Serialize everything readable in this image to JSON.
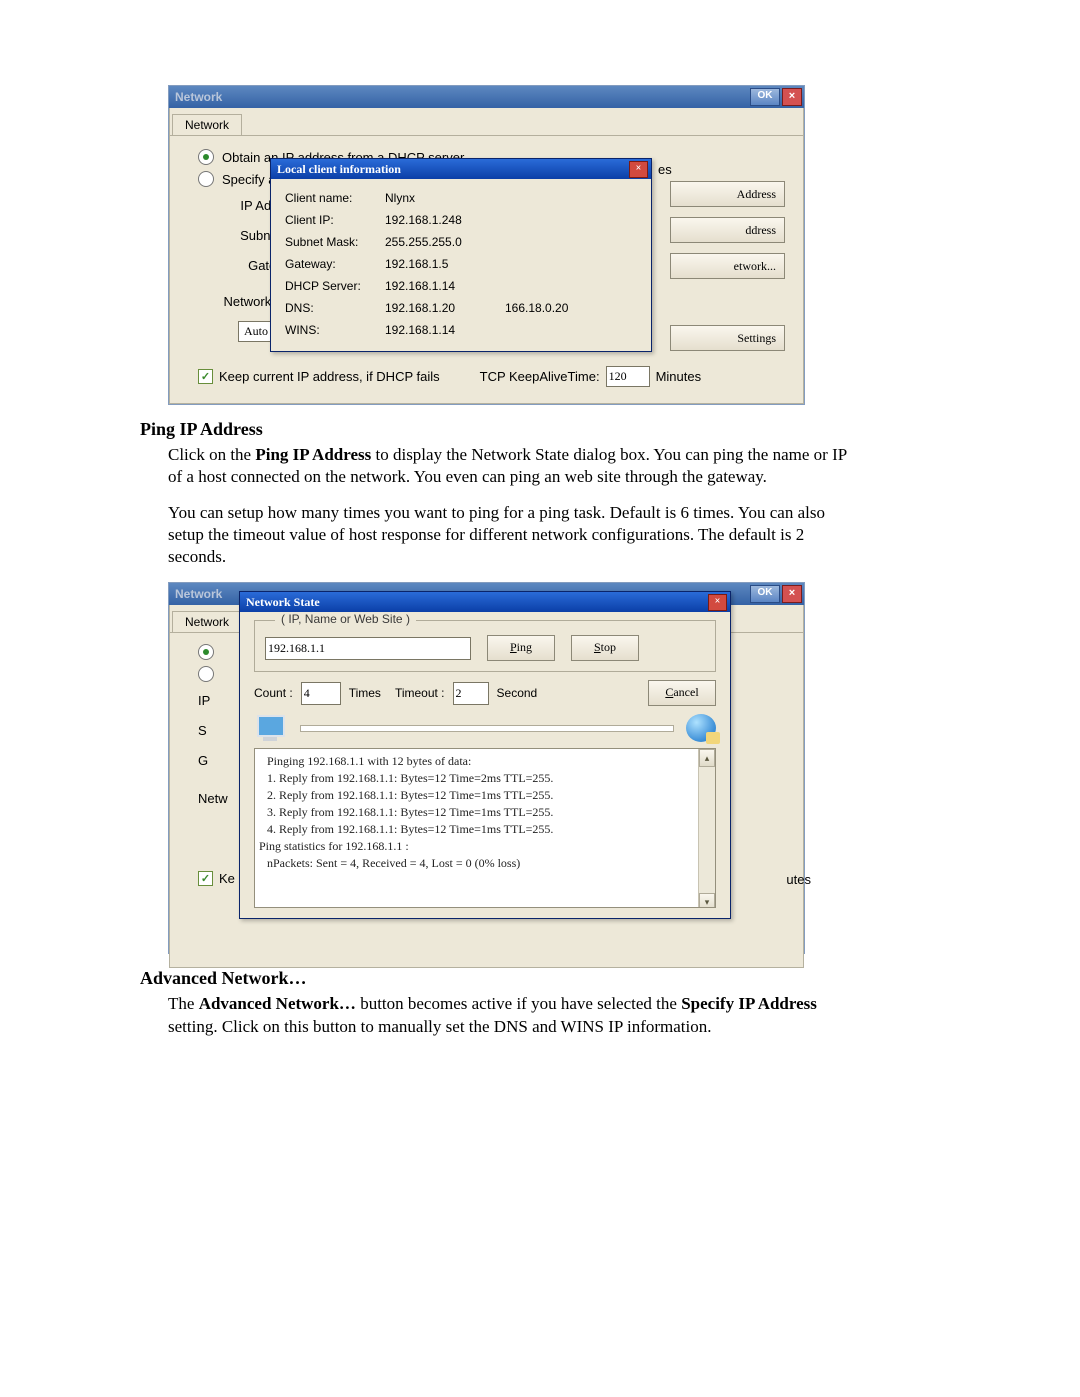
{
  "shot1": {
    "windowTitle": "Network",
    "ok": "OK",
    "tab": "Network",
    "radio1": "Obtain an IP address from a DHCP server",
    "radio2_prefix": "Specify a",
    "radio2_tail": "es",
    "labels": {
      "ip": "IP Address",
      "mask": "Subnet Ma",
      "gw": "Gateway:",
      "speed": "Network spee"
    },
    "sideButtons": {
      "b1": "Address",
      "b2": "ddress",
      "b3": "etwork...",
      "b4": "Settings"
    },
    "combo": "Auto De",
    "keep": "Keep current IP address, if DHCP fails",
    "keepAliveLabel": "TCP KeepAliveTime:",
    "keepAliveValue": "120",
    "keepAliveUnit": "Minutes",
    "overlay": {
      "title": "Local client information",
      "rows": {
        "clientName": {
          "k": "Client name:",
          "v": "Nlynx"
        },
        "clientIP": {
          "k": "Client IP:",
          "v": "192.168.1.248"
        },
        "mask": {
          "k": "Subnet Mask:",
          "v": "255.255.255.0"
        },
        "gw": {
          "k": "Gateway:",
          "v": "192.168.1.5"
        },
        "dhcp": {
          "k": "DHCP Server:",
          "v": "192.168.1.14"
        },
        "dns": {
          "k": "DNS:",
          "v": "192.168.1.20",
          "v2": "166.18.0.20"
        },
        "wins": {
          "k": "WINS:",
          "v": "192.168.1.14"
        }
      }
    }
  },
  "text": {
    "h1": "Ping IP Address",
    "p1a": "Click on the ",
    "p1b": "Ping IP Address",
    "p1c": " to display the Network State dialog box.  You can ping the name or IP of a host connected on the network. You even can ping an web site through the gateway.",
    "p2": "You can setup how many times you want to ping for a ping task. Default is 6 times.  You can also setup the timeout value of host response for different network configurations.  The default is 2 seconds.",
    "h2": "Advanced Network…",
    "p3a": "The ",
    "p3b": "Advanced Network…",
    "p3c": " button becomes active if you have selected the ",
    "p3d": "Specify IP Address",
    "p3e": " setting.  Click on this button to manually set the DNS and WINS IP information."
  },
  "shot2": {
    "windowTitle": "Network",
    "ok": "OK",
    "tab": "Network",
    "labels": {
      "ip": "IP",
      "s": "S",
      "g": "G",
      "netw": "Netw",
      "ke": "Ke",
      "utes": "utes"
    },
    "dlg": {
      "title": "Network State",
      "fieldset": "(  IP,  Name or Web Site  )",
      "host": "192.168.1.1",
      "ping": "Ping",
      "stop": "Stop",
      "countLbl": "Count :",
      "countVal": "4",
      "times": "Times",
      "timeoutLbl": "Timeout :",
      "timeoutVal": "2",
      "second": "Second",
      "cancel": "Cancel",
      "out": [
        "Pinging 192.168.1.1 with 12 bytes of data:",
        "1. Reply from 192.168.1.1:  Bytes=12  Time=2ms  TTL=255.",
        "2. Reply from 192.168.1.1:  Bytes=12  Time=1ms  TTL=255.",
        "3. Reply from 192.168.1.1:  Bytes=12  Time=1ms  TTL=255.",
        "4. Reply from 192.168.1.1:  Bytes=12  Time=1ms  TTL=255.",
        "Ping statistics for 192.168.1.1 :",
        "      nPackets: Sent = 4, Received = 4, Lost = 0 (0% loss)"
      ]
    }
  }
}
